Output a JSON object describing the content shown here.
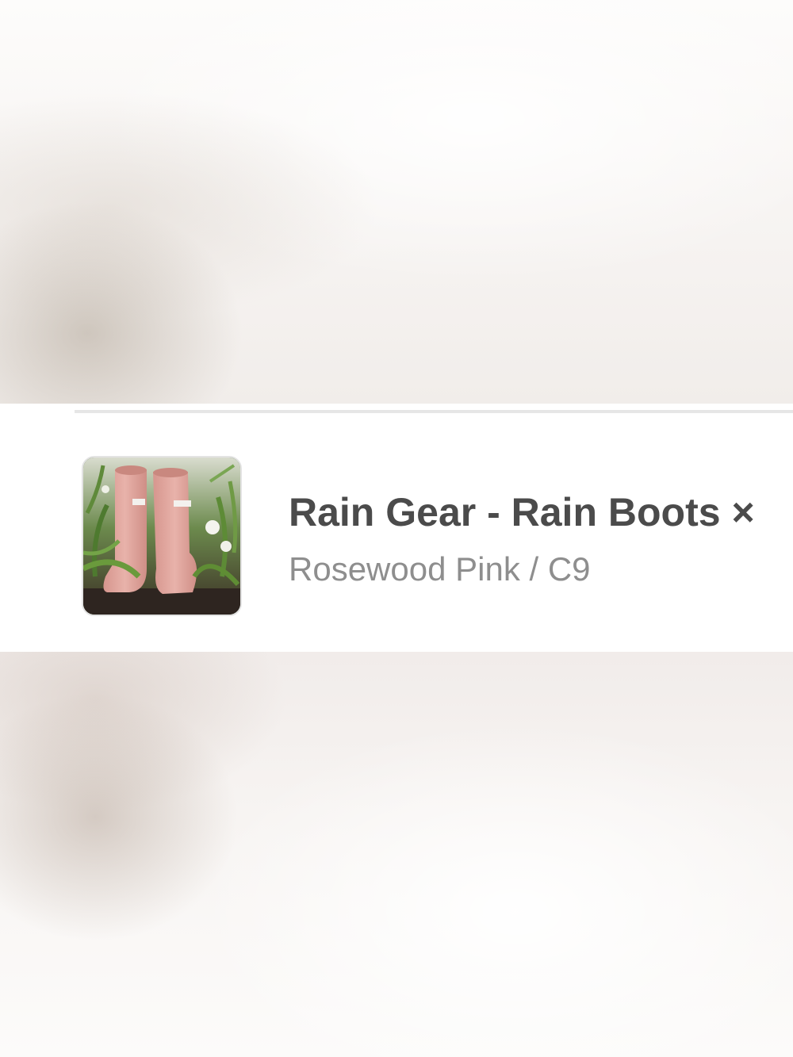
{
  "item": {
    "title": "Rain Gear - Rain Boots",
    "remove_symbol": "×",
    "variant": "Rosewood Pink / C9",
    "thumbnail_icon": "pink-rain-boots-photo"
  },
  "colors": {
    "title": "#4b4b4b",
    "variant": "#8e8e8e",
    "divider": "#e6e6e6",
    "boot": "#e2a8a0"
  }
}
